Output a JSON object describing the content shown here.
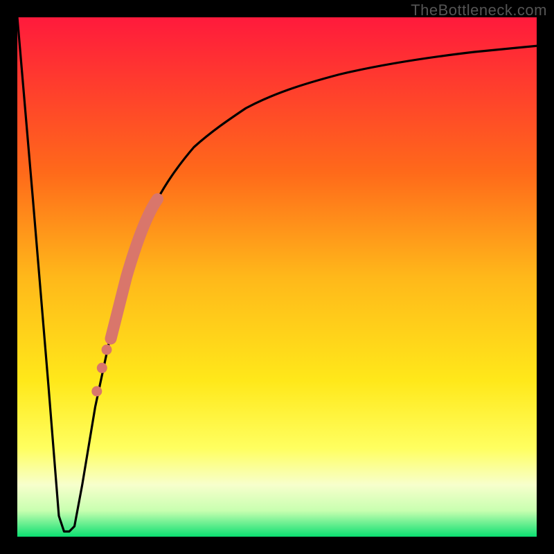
{
  "watermark": "TheBottleneck.com",
  "colors": {
    "top": "#ff1a3c",
    "middle_upper": "#ff8a1a",
    "middle": "#ffd81a",
    "middle_lower": "#ffff60",
    "pale": "#f7ffcc",
    "bottom": "#0bdf71",
    "curve": "#000000",
    "marker": "#d9766b",
    "frame": "#000000"
  },
  "chart_data": {
    "type": "line",
    "title": "",
    "xlabel": "",
    "ylabel": "",
    "xlim": [
      0,
      100
    ],
    "ylim": [
      0,
      100
    ],
    "background": "gradient red→green (vertical)",
    "series": [
      {
        "name": "bottleneck-curve",
        "x": [
          0,
          3,
          6,
          8,
          9,
          10,
          11,
          12.5,
          15,
          18,
          21,
          24,
          27,
          30,
          34,
          38,
          44,
          52,
          62,
          74,
          88,
          100
        ],
        "y": [
          100,
          65,
          29,
          4,
          1,
          1,
          2,
          10,
          25,
          39,
          50,
          58,
          65,
          70,
          75,
          79,
          83,
          87,
          90,
          92,
          93.5,
          94.5
        ]
      }
    ],
    "annotations": [
      {
        "name": "target-band",
        "description": "highlighted segment of curve (thick salmon overlay)",
        "x_range": [
          18,
          27
        ],
        "y_range": [
          38,
          65
        ]
      },
      {
        "name": "target-dot-1",
        "x": 17.2,
        "y": 36
      },
      {
        "name": "target-dot-2",
        "x": 16.3,
        "y": 32.5
      },
      {
        "name": "target-dot-3",
        "x": 15.3,
        "y": 28
      }
    ]
  }
}
